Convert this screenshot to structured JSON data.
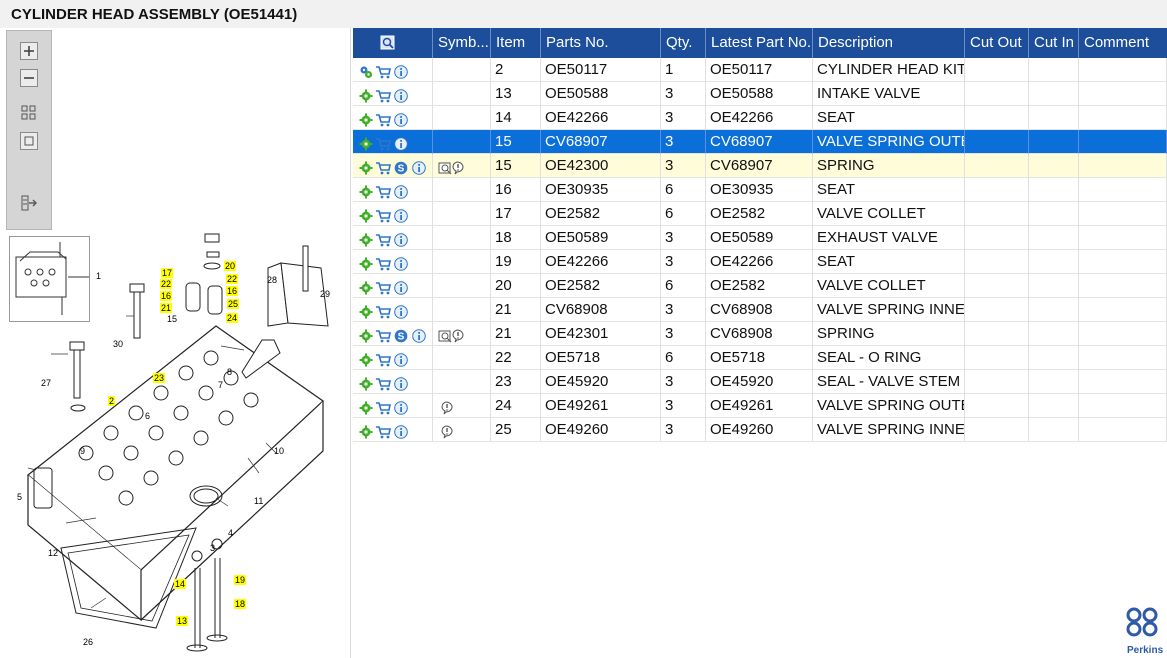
{
  "title": "CYLINDER HEAD ASSEMBLY (OE51441)",
  "toolbar": {
    "icons": [
      "zoom-in-icon",
      "zoom-out-icon",
      "fit-window-icon",
      "actual-size-icon",
      "export-icon"
    ]
  },
  "diagram": {
    "callouts_highlighted": [
      "17",
      "22",
      "16",
      "21",
      "20",
      "22",
      "16",
      "25",
      "24",
      "23",
      "2",
      "14",
      "19",
      "18",
      "13"
    ],
    "callouts_plain": [
      "1",
      "28",
      "29",
      "30",
      "27",
      "8",
      "7",
      "6",
      "9",
      "10",
      "5",
      "11",
      "4",
      "3",
      "12",
      "26",
      "15"
    ]
  },
  "table": {
    "headers": [
      "",
      "Symb...",
      "Item",
      "Parts No.",
      "Qty.",
      "Latest Part No.",
      "Description",
      "Cut Out",
      "Cut In",
      "Comment"
    ],
    "rows": [
      {
        "item": "2",
        "parts_no": "OE50117",
        "qty": "1",
        "latest": "OE50117",
        "desc": "CYLINDER HEAD KIT -",
        "first_icon": "gears",
        "extra": false,
        "symb": ""
      },
      {
        "item": "13",
        "parts_no": "OE50588",
        "qty": "3",
        "latest": "OE50588",
        "desc": "INTAKE VALVE",
        "first_icon": "gear",
        "extra": false,
        "symb": ""
      },
      {
        "item": "14",
        "parts_no": "OE42266",
        "qty": "3",
        "latest": "OE42266",
        "desc": "SEAT",
        "first_icon": "gear",
        "extra": false,
        "symb": ""
      },
      {
        "item": "15",
        "parts_no": "CV68907",
        "qty": "3",
        "latest": "CV68907",
        "desc": "VALVE SPRING OUTER",
        "first_icon": "gear",
        "extra": false,
        "symb": "",
        "selected": true
      },
      {
        "item": "15",
        "parts_no": "OE42300",
        "qty": "3",
        "latest": "CV68907",
        "desc": "SPRING",
        "first_icon": "gear",
        "extra": true,
        "symb": "supersede",
        "superseded": true
      },
      {
        "item": "16",
        "parts_no": "OE30935",
        "qty": "6",
        "latest": "OE30935",
        "desc": "SEAT",
        "first_icon": "gear",
        "extra": false,
        "symb": ""
      },
      {
        "item": "17",
        "parts_no": "OE2582",
        "qty": "6",
        "latest": "OE2582",
        "desc": "VALVE COLLET",
        "first_icon": "gear",
        "extra": false,
        "symb": ""
      },
      {
        "item": "18",
        "parts_no": "OE50589",
        "qty": "3",
        "latest": "OE50589",
        "desc": "EXHAUST VALVE",
        "first_icon": "gear",
        "extra": false,
        "symb": ""
      },
      {
        "item": "19",
        "parts_no": "OE42266",
        "qty": "3",
        "latest": "OE42266",
        "desc": "SEAT",
        "first_icon": "gear",
        "extra": false,
        "symb": ""
      },
      {
        "item": "20",
        "parts_no": "OE2582",
        "qty": "6",
        "latest": "OE2582",
        "desc": "VALVE COLLET",
        "first_icon": "gear",
        "extra": false,
        "symb": ""
      },
      {
        "item": "21",
        "parts_no": "CV68908",
        "qty": "3",
        "latest": "CV68908",
        "desc": "VALVE SPRING INNER",
        "first_icon": "gear",
        "extra": false,
        "symb": ""
      },
      {
        "item": "21",
        "parts_no": "OE42301",
        "qty": "3",
        "latest": "CV68908",
        "desc": "SPRING",
        "first_icon": "gear",
        "extra": true,
        "symb": "supersede"
      },
      {
        "item": "22",
        "parts_no": "OE5718",
        "qty": "6",
        "latest": "OE5718",
        "desc": "SEAL - O RING",
        "first_icon": "gear",
        "extra": false,
        "symb": ""
      },
      {
        "item": "23",
        "parts_no": "OE45920",
        "qty": "3",
        "latest": "OE45920",
        "desc": "SEAL - VALVE STEM",
        "first_icon": "gear",
        "extra": false,
        "symb": ""
      },
      {
        "item": "24",
        "parts_no": "OE49261",
        "qty": "3",
        "latest": "OE49261",
        "desc": "VALVE SPRING OUTER",
        "first_icon": "gear",
        "extra": false,
        "symb": "note"
      },
      {
        "item": "25",
        "parts_no": "OE49260",
        "qty": "3",
        "latest": "OE49260",
        "desc": "VALVE SPRING INNER",
        "first_icon": "gear",
        "extra": false,
        "symb": "note"
      }
    ]
  },
  "brand": {
    "name": "Perkins",
    "color": "#2f5aa8"
  },
  "colors": {
    "header": "#1c4e9c",
    "selected": "#0a6fd8",
    "superseded_row": "#fefcd9",
    "highlight_label": "#ffff00",
    "gear": "#3fae29",
    "info": "#2f76c8"
  }
}
